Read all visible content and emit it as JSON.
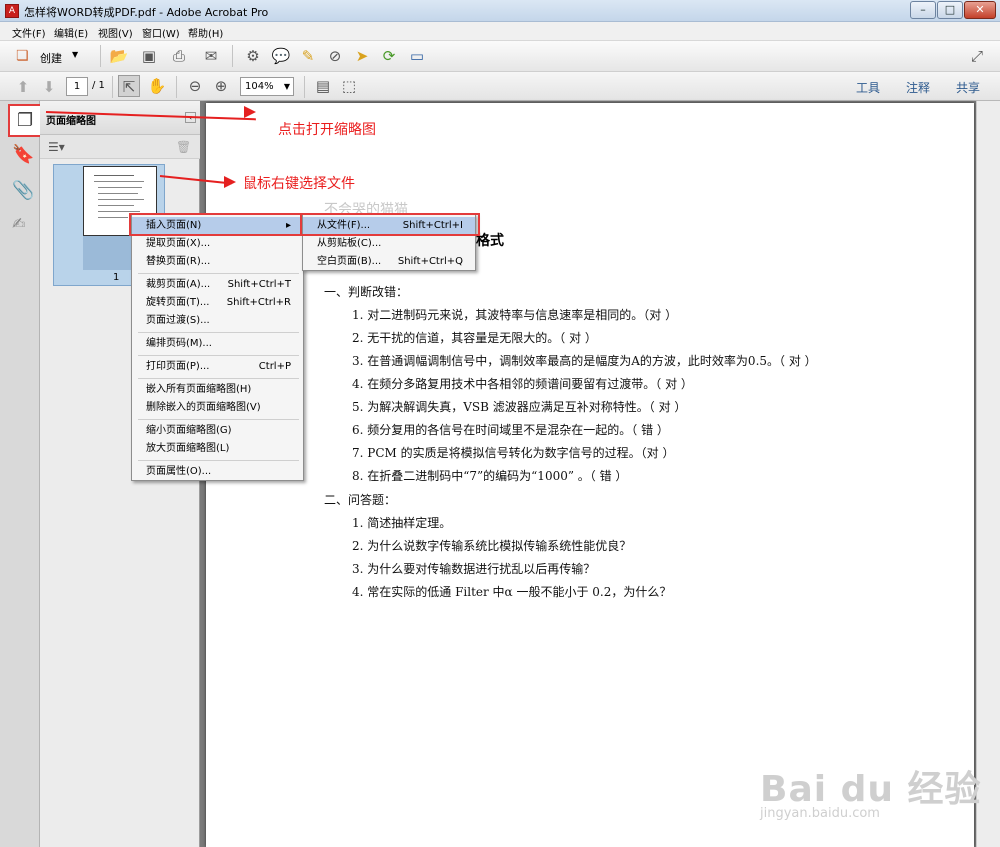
{
  "window": {
    "title": "怎样将WORD转成PDF.pdf - Adobe Acrobat Pro",
    "buttons": {
      "minimize": "–",
      "maximize": "□",
      "close": "✕"
    }
  },
  "menubar": {
    "items": [
      "文件(F)",
      "编辑(E)",
      "视图(V)",
      "窗口(W)",
      "帮助(H)"
    ]
  },
  "toolbar": {
    "create_label": "创建",
    "page_current": "1",
    "page_total": "/ 1",
    "zoom": "104%",
    "right_tools": [
      "工具",
      "注释",
      "共享"
    ]
  },
  "panel": {
    "title": "页面缩略图",
    "thumb_page_number": "1"
  },
  "annotations": {
    "open_thumbnails": "点击打开缩略图",
    "right_click": "鼠标右键选择文件"
  },
  "context_menu": {
    "main": [
      {
        "label": "插入页面(N)",
        "shortcut": "",
        "submenu": true
      },
      {
        "label": "提取页面(X)...",
        "shortcut": ""
      },
      {
        "label": "替换页面(R)...",
        "shortcut": ""
      },
      {
        "label": "裁剪页面(A)...",
        "shortcut": "Shift+Ctrl+T"
      },
      {
        "label": "旋转页面(T)...",
        "shortcut": "Shift+Ctrl+R"
      },
      {
        "label": "页面过渡(S)...",
        "shortcut": ""
      },
      {
        "label": "编排页码(M)...",
        "shortcut": ""
      },
      {
        "label": "打印页面(P)...",
        "shortcut": "Ctrl+P"
      },
      {
        "label": "嵌入所有页面缩略图(H)",
        "shortcut": ""
      },
      {
        "label": "删除嵌入的页面缩略图(V)",
        "shortcut": ""
      },
      {
        "label": "缩小页面缩略图(G)",
        "shortcut": ""
      },
      {
        "label": "放大页面缩略图(L)",
        "shortcut": ""
      },
      {
        "label": "页面属性(O)...",
        "shortcut": ""
      }
    ],
    "sub": [
      {
        "label": "从文件(F)...",
        "shortcut": "Shift+Ctrl+I"
      },
      {
        "label": "从剪贴板(C)...",
        "shortcut": ""
      },
      {
        "label": "空白页面(B)...",
        "shortcut": "Shift+Ctrl+Q"
      }
    ]
  },
  "document": {
    "faded_author": "不会哭的猫猫",
    "heading_fragment": "格式",
    "section1": "一、判断改错：",
    "items1": [
      "1.   对二进制码元来说，其波特率与信息速率是相同的。（对  ）",
      "2.   无干扰的信道，其容量是无限大的。（  对    ）",
      "3.   在普通调幅调制信号中，调制效率最高的是幅度为A的方波，此时效率为0.5。（  对    ）",
      "4.   在频分多路复用技术中各相邻的频谱间要留有过渡带。（   对    ）",
      "5.   为解决解调失真，VSB 滤波器应满足互补对称特性。（   对    ）",
      "6.   频分复用的各信号在时间域里不是混杂在一起的。（    错    ）",
      "7.   PCM 的实质是将模拟信号转化为数字信号的过程。（对    ）",
      "8.   在折叠二进制码中“7”的编码为“1000”  。（  错     ）"
    ],
    "section2": "二、问答题：",
    "items2": [
      "1.   简述抽样定理。",
      "2.   为什么说数字传输系统比模拟传输系统性能优良？",
      "3.   为什么要对传输数据进行扰乱以后再传输？",
      "4.   常在实际的低通 Filter 中α 一般不能小于 0.2，为什么？"
    ]
  },
  "watermark": {
    "main": "Bai du 经验",
    "sub": "jingyan.baidu.com"
  }
}
